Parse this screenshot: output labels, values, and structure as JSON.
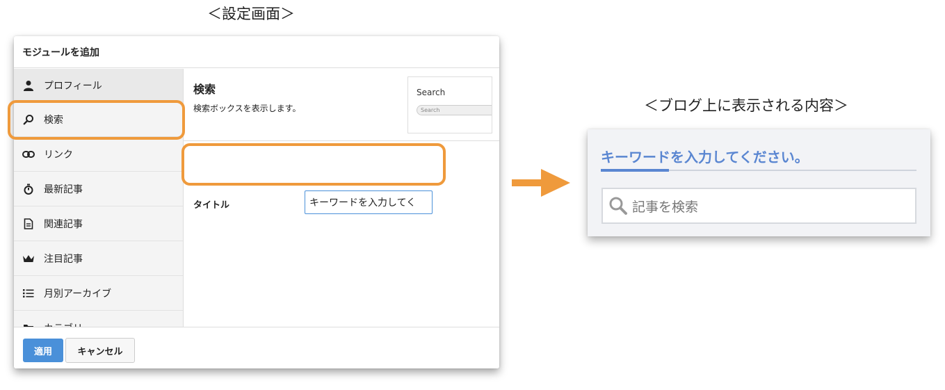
{
  "captions": {
    "settings": "＜設定画面＞",
    "blog": "＜ブログ上に表示される内容＞"
  },
  "dialog": {
    "title": "モジュールを追加",
    "sidebar": [
      {
        "label": "プロフィール",
        "icon": "person-icon"
      },
      {
        "label": "検索",
        "icon": "search-icon"
      },
      {
        "label": "リンク",
        "icon": "link-icon"
      },
      {
        "label": "最新記事",
        "icon": "stopwatch-icon"
      },
      {
        "label": "関連記事",
        "icon": "document-icon"
      },
      {
        "label": "注目記事",
        "icon": "crown-icon"
      },
      {
        "label": "月別アーカイブ",
        "icon": "list-icon"
      },
      {
        "label": "カテゴリ",
        "icon": "folder-icon"
      }
    ],
    "main": {
      "title": "検索",
      "description": "検索ボックスを表示します。",
      "preview": {
        "title": "Search",
        "placeholder": "Search"
      },
      "field_label": "タイトル",
      "field_value": "キーワードを入力してく"
    },
    "footer": {
      "apply": "適用",
      "cancel": "キャンセル"
    }
  },
  "blog_widget": {
    "heading": "キーワードを入力してください。",
    "search_placeholder": "記事を検索"
  },
  "colors": {
    "highlight": "#ef9a3c",
    "accent": "#4a90d9",
    "blog_heading": "#5a86d1"
  }
}
